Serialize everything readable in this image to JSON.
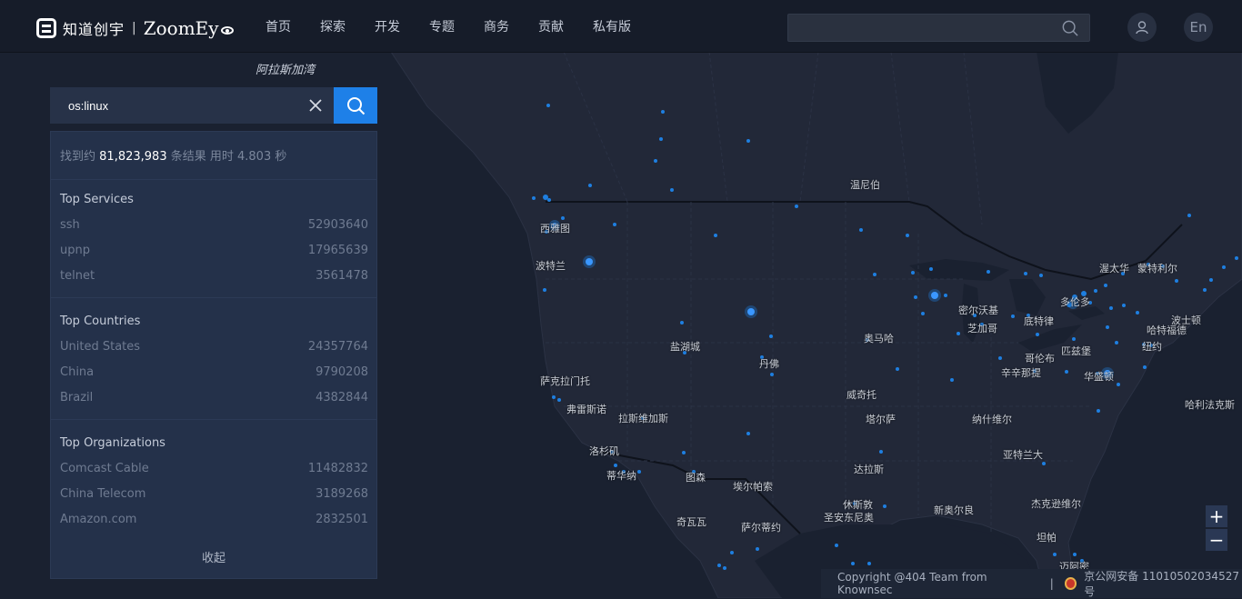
{
  "header": {
    "logo_cn": "知道创宇",
    "logo_sep": "|",
    "logo_en": "ZoomEy",
    "nav": [
      "首页",
      "探索",
      "开发",
      "专题",
      "商务",
      "贡献",
      "私有版"
    ],
    "search_value": "",
    "lang": "En"
  },
  "search": {
    "query": "os:linux"
  },
  "results": {
    "prefix": "找到约",
    "count": "81,823,983",
    "suffix": "条结果 用时 4.803 秒"
  },
  "top_services": {
    "title": "Top Services",
    "items": [
      {
        "name": "ssh",
        "count": "52903640"
      },
      {
        "name": "upnp",
        "count": "17965639"
      },
      {
        "name": "telnet",
        "count": "3561478"
      }
    ]
  },
  "top_countries": {
    "title": "Top Countries",
    "items": [
      {
        "name": "United States",
        "count": "24357764"
      },
      {
        "name": "China",
        "count": "9790208"
      },
      {
        "name": "Brazil",
        "count": "4382844"
      }
    ]
  },
  "top_orgs": {
    "title": "Top Organizations",
    "items": [
      {
        "name": "Comcast Cable",
        "count": "11482832"
      },
      {
        "name": "China Telecom",
        "count": "3189268"
      },
      {
        "name": "Amazon.com",
        "count": "2832501"
      }
    ]
  },
  "collapse_label": "收起",
  "map": {
    "sea_label": "阿拉斯加湾",
    "cities": [
      "温尼伯",
      "西雅图",
      "波特兰",
      "盐湖城",
      "丹佛",
      "奥马哈",
      "密尔沃基",
      "芝加哥",
      "底特律",
      "多伦多",
      "渥太华",
      "蒙特利尔",
      "波士顿",
      "哈特福德",
      "纽约",
      "哈利法克斯",
      "匹兹堡",
      "哥伦布",
      "辛辛那提",
      "华盛顿",
      "纳什维尔",
      "亚特兰大",
      "威奇托",
      "塔尔萨",
      "萨克拉门托",
      "弗雷斯诺",
      "拉斯维加斯",
      "洛杉矶",
      "蒂华纳",
      "图森",
      "埃尔帕索",
      "达拉斯",
      "休斯敦",
      "圣安东尼奥",
      "新奥尔良",
      "杰克逊维尔",
      "坦帕",
      "迈阿密",
      "奇瓦瓦",
      "萨尔蒂约"
    ],
    "zoom_in": "+",
    "zoom_out": "−"
  },
  "footer": {
    "copyright": "Copyright @404 Team from Knownsec",
    "sep": "|",
    "icp": "京公网安备 11010502034527号"
  }
}
